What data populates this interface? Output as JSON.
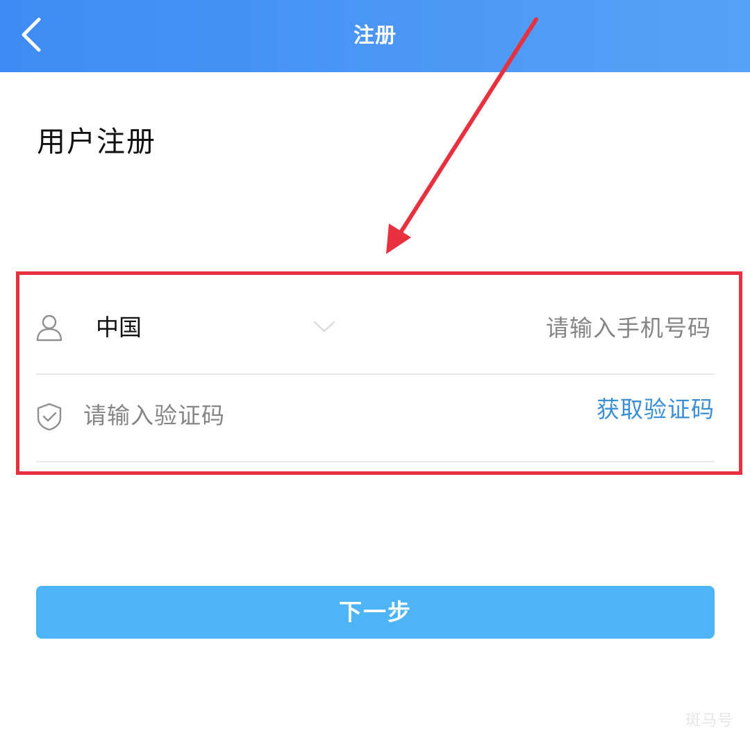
{
  "header": {
    "title": "注册",
    "back_icon": "chevron-left-icon"
  },
  "page_title": "用户注册",
  "phone_row": {
    "icon": "user-icon",
    "country": "中国",
    "chevron_icon": "chevron-down-icon",
    "placeholder": "请输入手机号码",
    "value": ""
  },
  "code_row": {
    "icon": "shield-check-icon",
    "placeholder": "请输入验证码",
    "value": "",
    "get_code_label": "获取验证码"
  },
  "next_button": {
    "label": "下一步"
  },
  "watermark": "斑马号",
  "colors": {
    "header_start": "#3e8bf3",
    "header_end": "#56a2f8",
    "button": "#4db5f5",
    "link": "#3a8ed6",
    "annotation": "#e8303f"
  }
}
